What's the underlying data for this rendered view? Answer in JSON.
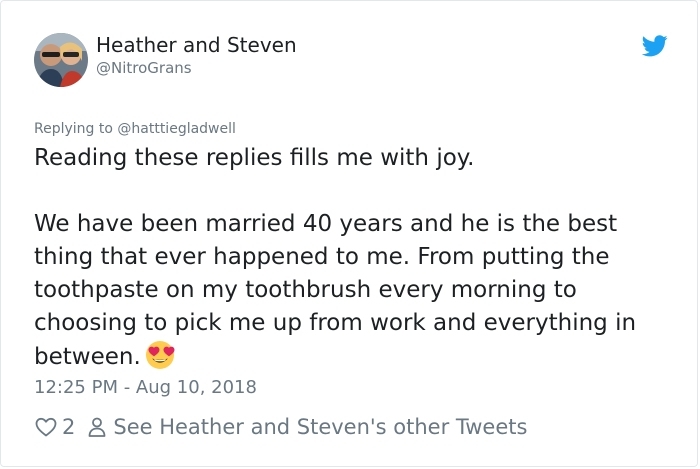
{
  "tweet": {
    "author_name": "Heather and Steven",
    "author_handle": "@NitroGrans",
    "replying_prefix": "Replying to ",
    "replying_to": "@hatttiegladwell",
    "paragraph_1": "Reading these replies fills me with joy.",
    "paragraph_2": "We have been married 40 years and he is the best thing that ever happened to me. From putting the toothpaste on my toothbrush every morning to choosing to pick me up from work and everything in between.",
    "emoji": "heart-eyes-emoji",
    "timestamp": "12:25 PM - Aug 10, 2018",
    "like_count": "2",
    "other_tweets_label": "See Heather and Steven's other Tweets"
  },
  "icons": {
    "brand": "twitter-bird-icon",
    "like": "heart-outline-icon",
    "profile": "person-outline-icon"
  },
  "colors": {
    "brand": "#1da1f2",
    "text": "#1c2022",
    "muted": "#697882",
    "border": "#e1e8ed"
  }
}
